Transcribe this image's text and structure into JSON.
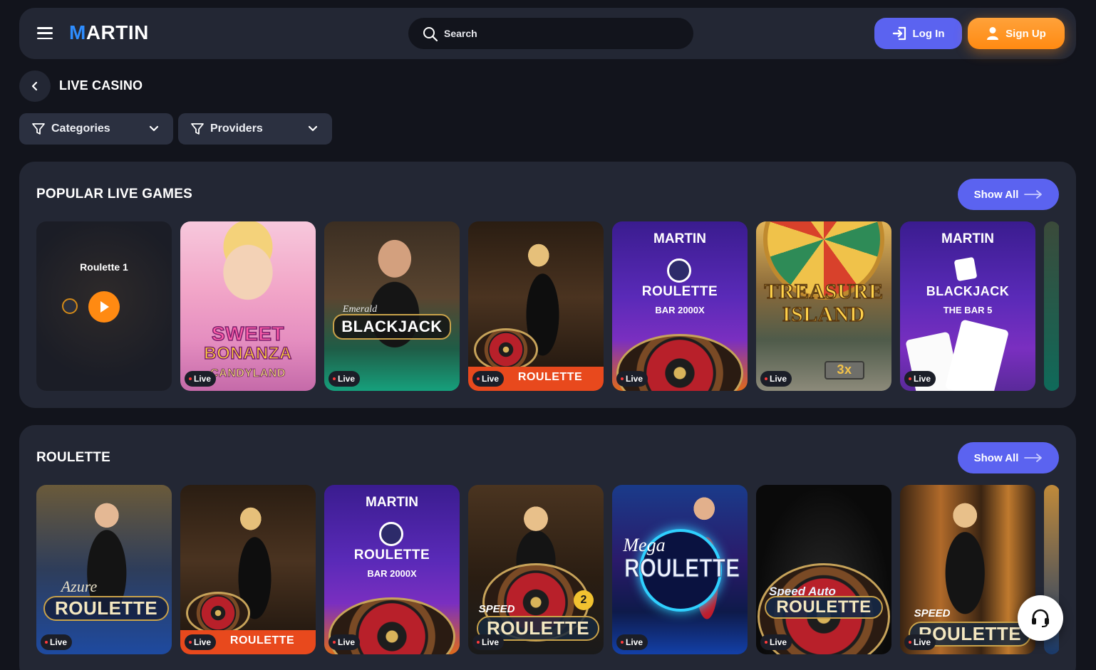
{
  "header": {
    "logo": "MARTIN",
    "search_placeholder": "Search",
    "login_label": "Log In",
    "signup_label": "Sign Up"
  },
  "page": {
    "title": "LIVE CASINO",
    "filters": [
      {
        "label": "Categories"
      },
      {
        "label": "Providers"
      }
    ]
  },
  "colors": {
    "background": "#12141c",
    "panel": "#232734",
    "accent_blue": "#5b63f0",
    "accent_orange": "#ff8a12",
    "live_dot": "#ff3b3b"
  },
  "sections": [
    {
      "title": "POPULAR LIVE GAMES",
      "show_all": "Show All",
      "cards": [
        {
          "kind": "hover",
          "title": "Roulette 1"
        },
        {
          "kind": "art",
          "lines": [
            "SWEET",
            "BONANZA",
            "CANDYLAND"
          ],
          "badge": "Live"
        },
        {
          "kind": "art",
          "lines": [
            "Emerald",
            "BLACKJACK"
          ],
          "badge": "Live"
        },
        {
          "kind": "art",
          "lines": [
            "ROULETTE"
          ],
          "badge": "Live"
        },
        {
          "kind": "art",
          "lines": [
            "MARTIN",
            "ROULETTE",
            "BAR 2000X"
          ],
          "badge": "Live"
        },
        {
          "kind": "art",
          "lines": [
            "TREASURE",
            "ISLAND",
            "3x"
          ],
          "badge": "Live"
        },
        {
          "kind": "art",
          "lines": [
            "MARTIN",
            "BLACKJACK",
            "THE BAR 5"
          ],
          "badge": "Live"
        }
      ]
    },
    {
      "title": "ROULETTE",
      "show_all": "Show All",
      "cards": [
        {
          "lines": [
            "Azure",
            "ROULETTE"
          ],
          "badge": "Live"
        },
        {
          "lines": [
            "ROULETTE"
          ],
          "badge": "Live"
        },
        {
          "lines": [
            "MARTIN",
            "ROULETTE",
            "BAR 2000X"
          ],
          "badge": "Live"
        },
        {
          "lines": [
            "SPEED",
            "ROULETTE",
            "2"
          ],
          "badge": "Live"
        },
        {
          "lines": [
            "Mega",
            "ROULETTE"
          ],
          "badge": "Live"
        },
        {
          "lines": [
            "Speed Auto",
            "ROULETTE"
          ],
          "badge": "Live"
        },
        {
          "lines": [
            "SPEED",
            "ROULETTE"
          ],
          "badge": "Live"
        }
      ]
    }
  ],
  "icons": {
    "menu": "hamburger-icon",
    "search": "search-icon",
    "login": "login-icon",
    "signup": "user-icon",
    "back": "chevron-left-icon",
    "filter": "filter-icon",
    "dropdown": "chevron-down-icon",
    "show_all": "arrow-right-icon",
    "play": "play-icon",
    "support": "headset-icon"
  }
}
